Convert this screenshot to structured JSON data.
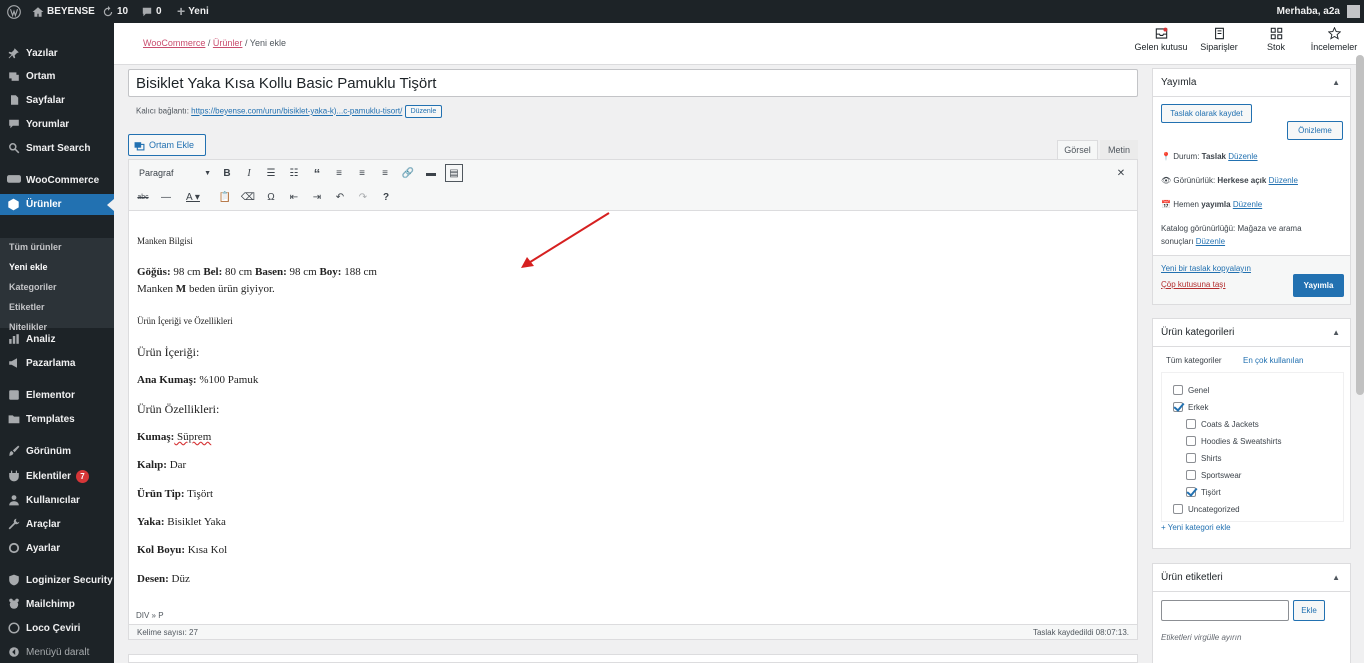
{
  "adminbar": {
    "site": "BEYENSE",
    "updates": "10",
    "comments": "0",
    "new": "Yeni",
    "greeting": "Merhaba, a2a"
  },
  "sidebar": {
    "items": [
      {
        "label": "Yazılar",
        "icon": "pushpin-icon"
      },
      {
        "label": "Ortam",
        "icon": "media-icon"
      },
      {
        "label": "Sayfalar",
        "icon": "page-icon"
      },
      {
        "label": "Yorumlar",
        "icon": "comment-icon"
      },
      {
        "label": "Smart Search",
        "icon": "search-icon"
      },
      {
        "label": "WooCommerce",
        "icon": "woo-icon"
      },
      {
        "label": "Ürünler",
        "icon": "product-icon"
      },
      {
        "label": "Analiz",
        "icon": "chart-icon"
      },
      {
        "label": "Pazarlama",
        "icon": "megaphone-icon"
      },
      {
        "label": "Elementor",
        "icon": "elementor-icon"
      },
      {
        "label": "Templates",
        "icon": "folder-icon"
      },
      {
        "label": "Görünüm",
        "icon": "brush-icon"
      },
      {
        "label": "Eklentiler",
        "icon": "plugin-icon",
        "badge": "7"
      },
      {
        "label": "Kullanıcılar",
        "icon": "users-icon"
      },
      {
        "label": "Araçlar",
        "icon": "wrench-icon"
      },
      {
        "label": "Ayarlar",
        "icon": "settings-icon"
      },
      {
        "label": "Loginizer Security",
        "icon": "shield-icon"
      },
      {
        "label": "Mailchimp",
        "icon": "mailchimp-icon"
      },
      {
        "label": "Loco Çeviri",
        "icon": "translate-icon"
      },
      {
        "label": "Menüyü daralt",
        "icon": "collapse-icon"
      }
    ],
    "submenu": [
      "Tüm ürünler",
      "Yeni ekle",
      "Kategoriler",
      "Etiketler",
      "Nitelikler"
    ]
  },
  "header": {
    "breadcrumb": {
      "woo": "WooCommerce",
      "sep": "/",
      "products": "Ürünler",
      "current": "Yeni ekle"
    },
    "icons": [
      {
        "label": "Gelen kutusu",
        "icon": "inbox-icon"
      },
      {
        "label": "Siparişler",
        "icon": "orders-icon"
      },
      {
        "label": "Stok",
        "icon": "stock-icon"
      },
      {
        "label": "İncelemeler",
        "icon": "star-icon"
      }
    ]
  },
  "post": {
    "title": "Bisiklet Yaka Kısa Kollu Basic Pamuklu Tişört",
    "permalink_label": "Kalıcı bağlantı:",
    "permalink_url": "https://beyense.com/urun/bisiklet-yaka-k)...c-pamuklu-tisort/",
    "edit_btn": "Düzenle",
    "add_media": "Ortam Ekle",
    "tab_visual": "Görsel",
    "tab_text": "Metin",
    "format": "Paragraf"
  },
  "content": {
    "model_heading": "Manken Bilgisi",
    "measure_line": [
      {
        "b": "Göğüs:",
        "t": " 98 cm "
      },
      {
        "b": "Bel:",
        "t": " 80 cm "
      },
      {
        "b": "Basen:",
        "t": " 98 cm "
      },
      {
        "b": "Boy:",
        "t": " 188 cm"
      }
    ],
    "model_line": [
      {
        "b": "",
        "t": "Manken "
      },
      {
        "b": "M",
        "t": " beden ürün giyiyor."
      }
    ],
    "content_heading": "Ürün İçeriği ve Özellikleri",
    "h_content": "Ürün İçeriği:",
    "fabric": {
      "b": "Ana Kumaş:",
      "t": " %100 Pamuk"
    },
    "h_features": "Ürün Özellikleri:",
    "rows": [
      {
        "b": "Kumaş:",
        "t": " Süprem"
      },
      {
        "b": "Kalıp:",
        "t": " Dar"
      },
      {
        "b": "Ürün Tip:",
        "t": " Tişört"
      },
      {
        "b": "Yaka:",
        "t": " Bisiklet Yaka"
      },
      {
        "b": "Kol Boyu:",
        "t": " Kısa Kol"
      },
      {
        "b": "Desen:",
        "t": " Düz"
      }
    ],
    "path": "DIV » P",
    "word_count": "Kelime sayısı: 27",
    "saved": "Taslak kaydedildi 08:07:13."
  },
  "publish": {
    "title": "Yayımla",
    "save_draft": "Taslak olarak kaydet",
    "preview": "Önizleme",
    "status_label": "Durum:",
    "status_value": "Taslak",
    "status_edit": "Düzenle",
    "visibility_label": "Görünürlük:",
    "visibility_value": "Herkese açık",
    "visibility_edit": "Düzenle",
    "schedule_label": "Hemen",
    "schedule_value": "yayımla",
    "schedule_edit": "Düzenle",
    "catalog_line1": "Katalog görünürlüğü: Mağaza ve arama",
    "catalog_line2": "sonuçları",
    "catalog_edit": "Düzenle",
    "copy": "Yeni bir taslak kopyalayın",
    "trash": "Çöp kutusuna taşı",
    "publish_btn": "Yayımla"
  },
  "categories": {
    "title": "Ürün kategorileri",
    "tab_all": "Tüm kategoriler",
    "tab_popular": "En çok kullanılan",
    "items": [
      {
        "label": "Genel",
        "checked": false
      },
      {
        "label": "Erkek",
        "checked": true
      },
      {
        "label": "Coats & Jackets",
        "checked": false
      },
      {
        "label": "Hoodies & Sweatshirts",
        "checked": false
      },
      {
        "label": "Shirts",
        "checked": false
      },
      {
        "label": "Sportswear",
        "checked": false
      },
      {
        "label": "Tişört",
        "checked": true
      },
      {
        "label": "Uncategorized",
        "checked": false
      }
    ],
    "add": "+ Yeni kategori ekle"
  },
  "tags": {
    "title": "Ürün etiketleri",
    "add_btn": "Ekle",
    "hint": "Etiketleri virgülle ayırın"
  },
  "colors": {
    "accent": "#2271b1",
    "adminbar": "#1d2327",
    "arrow": "#d62020"
  }
}
